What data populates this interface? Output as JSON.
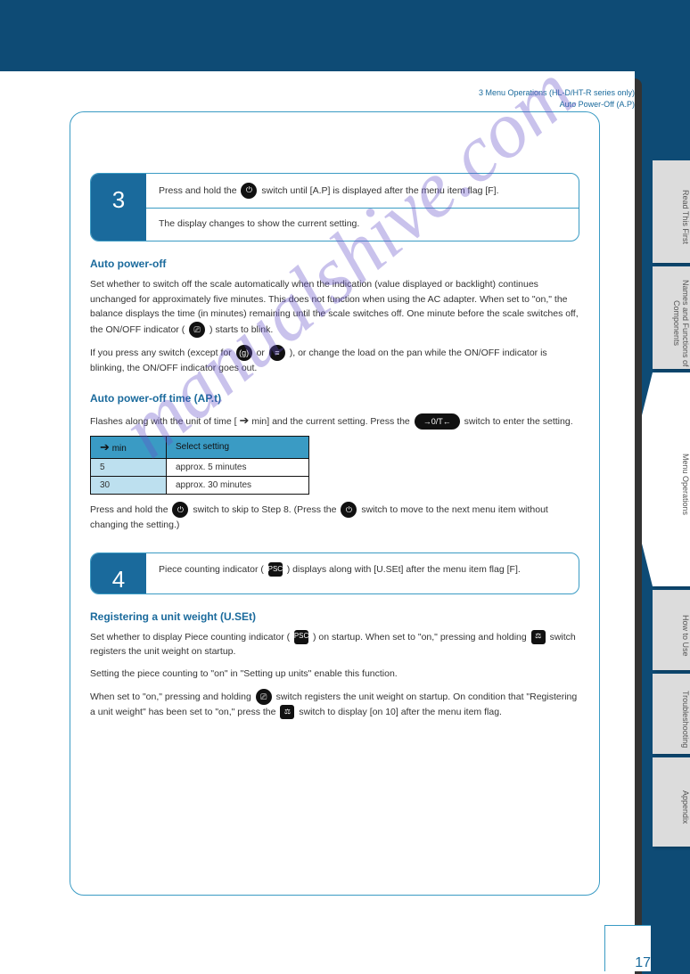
{
  "watermark": "manualshive.com",
  "header": {
    "line1": "3 Menu Operations (HL-D/HT-R series only)",
    "line2": "Auto Power-Off (A.P)"
  },
  "tabs": [
    "Read This First",
    "Names and Functions of Components",
    "Menu Operations",
    "How to Use",
    "Troubleshooting",
    "Appendix"
  ],
  "callout1": {
    "num": "3",
    "row1_pre": " Press and hold the ",
    "row1_post": " switch until [A.P] is displayed after the menu item flag [F].",
    "row2": "The display changes to show the current setting."
  },
  "section1": {
    "title": "Auto power-off",
    "p1_pre": "Set whether to switch off the scale automatically when the indication (value displayed or backlight) continues unchanged for approximately five minutes. This does not function when using the AC adapter. When set to \"on,\" the balance displays the time (in minutes) remaining until the scale switches off. One minute before the scale switches off, the ON/OFF indicator (",
    "p1_post": ") starts to blink.",
    "p2_pre": "If you press any switch (except for ",
    "p2_mid": " or ",
    "p2_post": "), or change the load on the pan while the ON/OFF indicator is blinking, the ON/OFF indicator goes out.",
    "title2": "Auto power-off time (AP.t)",
    "p3_pre": "Flashes along with the unit of time [ ",
    "p3_mid": " min] and the current setting. Press the ",
    "p3_post": " switch to enter the setting.",
    "tbl": {
      "h1": "min",
      "h2": "Select setting",
      "r1c1": "5",
      "r1c2": "approx. 5 minutes",
      "r2c1": "30",
      "r2c2": "approx. 30 minutes"
    },
    "note_pre": "Press and hold the ",
    "note_mid": " switch to skip to Step 8. (Press the ",
    "note_post": " switch to move to the next menu item without changing the setting.)"
  },
  "callout2": {
    "num": "4",
    "row_pre": "Piece counting indicator (",
    "row_post": ") displays along with [U.SEt] after the menu item flag [F]."
  },
  "section2": {
    "title": "Registering a unit weight (U.SEt)",
    "p1_pre": "Set whether to display Piece counting indicator (",
    "p1_mid": ") on startup. When set to \"on,\" pressing and holding ",
    "p1_post": " switch registers the unit weight on startup.",
    "p2": "Setting the piece counting to \"on\" in \"Setting up units\" enable this function.",
    "p3_pre": "When set to \"on,\" pressing and holding ",
    "p3_mid": " switch registers the unit weight on startup. On condition that \"Registering a unit weight\" has been set to \"on,\" press the ",
    "p3_post": " switch to display [on 10] after the menu item flag."
  },
  "pageNumber": "17"
}
